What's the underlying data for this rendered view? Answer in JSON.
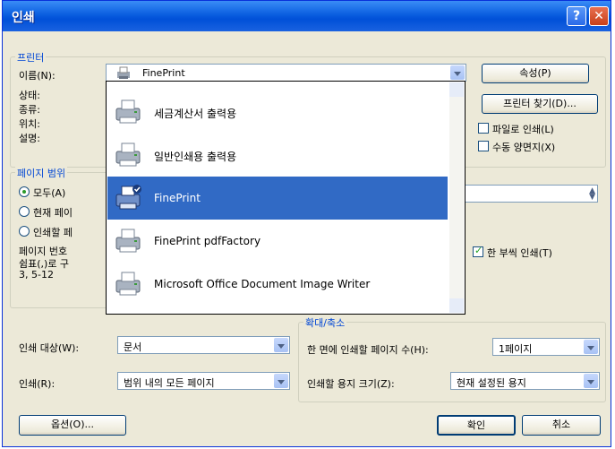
{
  "window": {
    "title": "인쇄",
    "help": "?",
    "close": "✕"
  },
  "printer_group": {
    "label": "프린터",
    "name_label": "이름(N):",
    "selected_printer": "FinePrint",
    "status_label": "상태:",
    "type_label": "종류:",
    "where_label": "위치:",
    "comment_label": "설명:",
    "properties_button": "속성(P)",
    "find_printer_button": "프린터 찾기(D)...",
    "print_to_file": "파일로 인쇄(L)",
    "manual_duplex": "수동 양면지(X)"
  },
  "dropdown": {
    "items": [
      {
        "label": "세금계산서 출력용",
        "selected": false
      },
      {
        "label": "일반인쇄용 출력용",
        "selected": false
      },
      {
        "label": "FinePrint",
        "selected": true
      },
      {
        "label": "FinePrint pdfFactory",
        "selected": false
      },
      {
        "label": "Microsoft Office Document Image Writer",
        "selected": false
      }
    ]
  },
  "page_range_group": {
    "label": "페이지 범위",
    "all": "모두(A)",
    "current_page": "현재 페이",
    "pages": "인쇄할 페",
    "hint_line1": "페이지 번호",
    "hint_line2": "쉼표(,)로 구",
    "hint_line3": "3, 5-12"
  },
  "copies": {
    "collate": "한 부씩 인쇄(T)"
  },
  "zoom_group": {
    "label": "확대/축소",
    "pages_per_sheet_label": "한 면에 인쇄할 페이지 수(H):",
    "pages_per_sheet_value": "1페이지",
    "scale_to_paper_label": "인쇄할 용지 크기(Z):",
    "scale_to_paper_value": "현재 설정된 용지"
  },
  "print_what": {
    "label": "인쇄 대상(W):",
    "value": "문서"
  },
  "print_option": {
    "label": "인쇄(R):",
    "value": "범위 내의 모든 페이지"
  },
  "footer": {
    "options_button": "옵션(O)...",
    "ok_button": "확인",
    "cancel_button": "취소"
  },
  "colors": {
    "title_blue": "#0a5ee0",
    "selection": "#316ac5",
    "group_label": "#0046d5"
  }
}
